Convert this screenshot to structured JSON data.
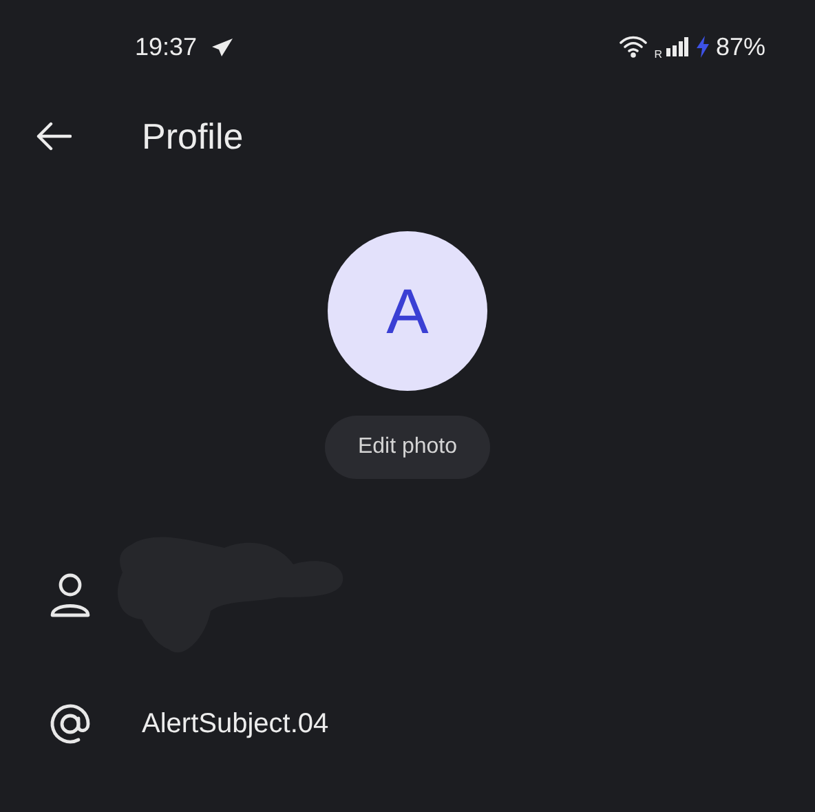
{
  "status_bar": {
    "time": "19:37",
    "battery": "87%",
    "charging": true,
    "roaming_mark": "R"
  },
  "header": {
    "title": "Profile"
  },
  "avatar": {
    "initial": "A"
  },
  "edit_photo": {
    "label": "Edit photo"
  },
  "fields": [
    {
      "kind": "name",
      "redacted": true
    },
    {
      "kind": "username",
      "redacted": false,
      "value": "AlertSubject.04"
    }
  ]
}
